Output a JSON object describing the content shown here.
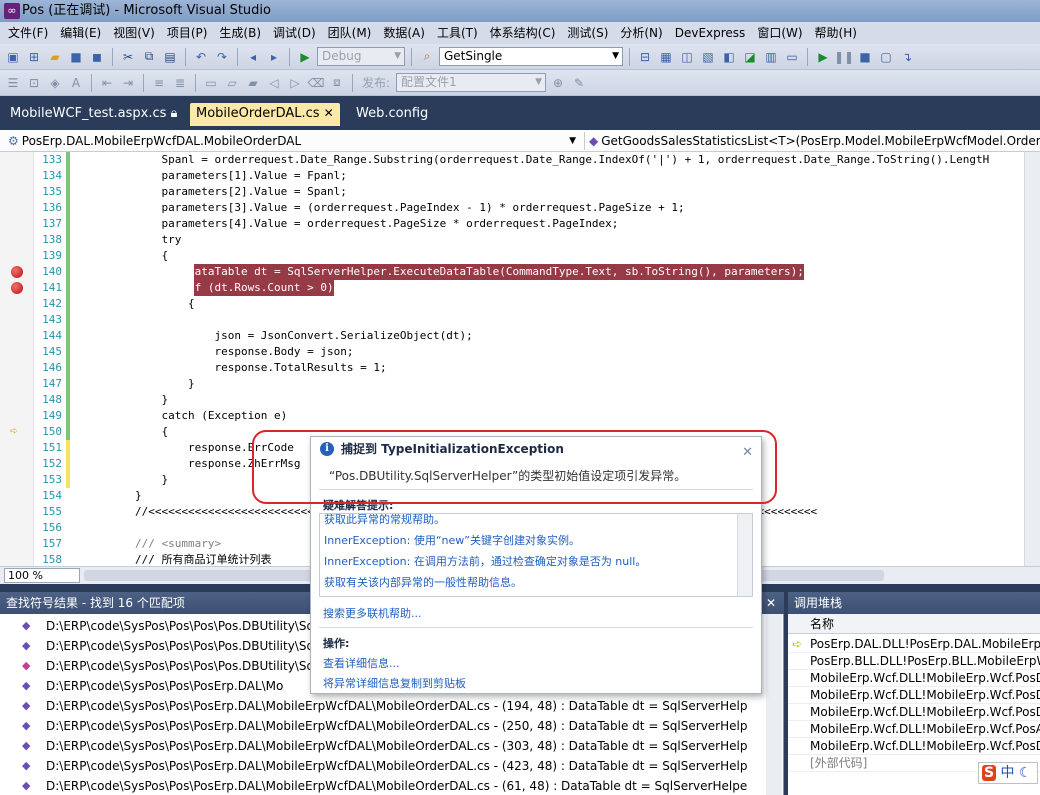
{
  "window": {
    "title": "Pos (正在调试) - Microsoft Visual Studio"
  },
  "menu": [
    "文件(F)",
    "编辑(E)",
    "视图(V)",
    "项目(P)",
    "生成(B)",
    "调试(D)",
    "团队(M)",
    "数据(A)",
    "工具(T)",
    "体系结构(C)",
    "测试(S)",
    "分析(N)",
    "DevExpress",
    "窗口(W)",
    "帮助(H)"
  ],
  "toolbar1": {
    "config": "Debug",
    "find_combo": "GetSingle"
  },
  "toolbar2": {
    "publish_label": "发布:",
    "publish_combo": "配置文件1"
  },
  "tabs": [
    {
      "label": "MobileWCF_test.aspx.cs"
    },
    {
      "label": "MobileOrderDAL.cs"
    },
    {
      "label": "Web.config"
    }
  ],
  "nav": {
    "class_sel": "PosErp.DAL.MobileErpWcfDAL.MobileOrderDAL",
    "member_sel": "GetGoodsSalesStatisticsList<T>(PosErp.Model.MobileErpWcfModel.OrderR"
  },
  "code": {
    "lines": [
      {
        "num": "133",
        "text": "            Spanl = orderrequest.Date_Range.Substring(orderrequest.Date_Range.IndexOf('|') + 1, orderrequest.Date_Range.ToString().LengtH"
      },
      {
        "num": "134",
        "text": "            parameters[1].Value = Fpanl;"
      },
      {
        "num": "135",
        "text": "            parameters[2].Value = Spanl;"
      },
      {
        "num": "136",
        "text": "            parameters[3].Value = (orderrequest.PageIndex - 1) * orderrequest.PageSize + 1;"
      },
      {
        "num": "137",
        "text": "            parameters[4].Value = orderrequest.PageSize * orderrequest.PageIndex;"
      },
      {
        "num": "138",
        "text": "            try"
      },
      {
        "num": "139",
        "text": "            {"
      },
      {
        "num": "140",
        "text": "                DataTable dt = SqlServerHelper.ExecuteDataTable(CommandType.Text, sb.ToString(), parameters);"
      },
      {
        "num": "141",
        "text": "                if (dt.Rows.Count > 0)"
      },
      {
        "num": "142",
        "text": "                {"
      },
      {
        "num": "143",
        "text": ""
      },
      {
        "num": "144",
        "text": "                    json = JsonConvert.SerializeObject(dt);"
      },
      {
        "num": "145",
        "text": "                    response.Body = json;"
      },
      {
        "num": "146",
        "text": "                    response.TotalResults = 1;"
      },
      {
        "num": "147",
        "text": "                }"
      },
      {
        "num": "148",
        "text": "            }"
      },
      {
        "num": "149",
        "text": "            catch (Exception e)"
      },
      {
        "num": "150",
        "text": "            {"
      },
      {
        "num": "151",
        "text": "                response.ErrCode"
      },
      {
        "num": "152",
        "text": "                response.ZhErrMsg"
      },
      {
        "num": "153",
        "text": "            }"
      },
      {
        "num": "154",
        "text": "        }"
      },
      {
        "num": "155",
        "text": "        //<<<<<<<<<<<<<<<<<<<<<<<<<<<<<<<<<<<<<<<<<<<<<<<<<<<<<<<<<<<<<<<<<<<<<<<<<<<<<<<<<<<<<<<<<<<<<<<<<<<<<"
      },
      {
        "num": "156",
        "text": ""
      },
      {
        "num": "157",
        "text": "        /// <summary>"
      },
      {
        "num": "158",
        "text": "        /// 所有商品订单统计列表"
      }
    ]
  },
  "zoom": "100 %",
  "find_panel": {
    "title": "查找符号结果 - 找到 16 个匹配项",
    "rows": [
      "D:\\ERP\\code\\SysPos\\Pos\\Pos\\Pos.DBUtility\\Sq",
      "D:\\ERP\\code\\SysPos\\Pos\\Pos\\Pos.DBUtility\\Sq",
      "D:\\ERP\\code\\SysPos\\Pos\\Pos\\Pos.DBUtility\\Sq",
      "D:\\ERP\\code\\SysPos\\Pos\\PosErp.DAL\\Mo",
      "D:\\ERP\\code\\SysPos\\Pos\\PosErp.DAL\\MobileErpWcfDAL\\MobileOrderDAL.cs - (194, 48) : DataTable dt = SqlServerHelp",
      "D:\\ERP\\code\\SysPos\\Pos\\PosErp.DAL\\MobileErpWcfDAL\\MobileOrderDAL.cs - (250, 48) : DataTable dt = SqlServerHelp",
      "D:\\ERP\\code\\SysPos\\Pos\\PosErp.DAL\\MobileErpWcfDAL\\MobileOrderDAL.cs - (303, 48) : DataTable dt = SqlServerHelp",
      "D:\\ERP\\code\\SysPos\\Pos\\PosErp.DAL\\MobileErpWcfDAL\\MobileOrderDAL.cs - (423, 48) : DataTable dt = SqlServerHelp",
      "D:\\ERP\\code\\SysPos\\Pos\\PosErp.DAL\\MobileErpWcfDAL\\MobileOrderDAL.cs - (61, 48) : DataTable dt = SqlServerHelpe"
    ]
  },
  "call_stack": {
    "title": "调用堆栈",
    "col_name": "名称",
    "rows": [
      "PosErp.DAL.DLL!PosErp.DAL.MobileErpWcfD",
      "PosErp.BLL.DLL!PosErp.BLL.MobileErpWcfBL",
      "MobileErp.Wcf.DLL!MobileErp.Wcf.PosDefau",
      "MobileErp.Wcf.DLL!MobileErp.Wcf.PosDefau",
      "MobileErp.Wcf.DLL!MobileErp.Wcf.PosDefau",
      "MobileErp.Wcf.DLL!MobileErp.Wcf.PosAPI.G",
      "MobileErp.Wcf.DLL!MobileErp.Wcf.PosDefau",
      "[外部代码]"
    ]
  },
  "exception": {
    "title": "捕捉到 TypeInitializationException",
    "message": "“Pos.DBUtility.SqlServerHelper”的类型初始值设定项引发异常。",
    "tips_header": "疑难解答提示:",
    "tips": [
      "获取此异常的常规帮助。",
      "InnerException: 使用“new”关键字创建对象实例。",
      "InnerException: 在调用方法前，通过检查确定对象是否为 null。",
      "获取有关该内部异常的一般性帮助信息。"
    ],
    "more_help": "搜索更多联机帮助...",
    "actions_header": "操作:",
    "actions": [
      "查看详细信息...",
      "将异常详细信息复制到剪贴板"
    ]
  },
  "ime": {
    "s_label": "S",
    "mode": "中"
  }
}
